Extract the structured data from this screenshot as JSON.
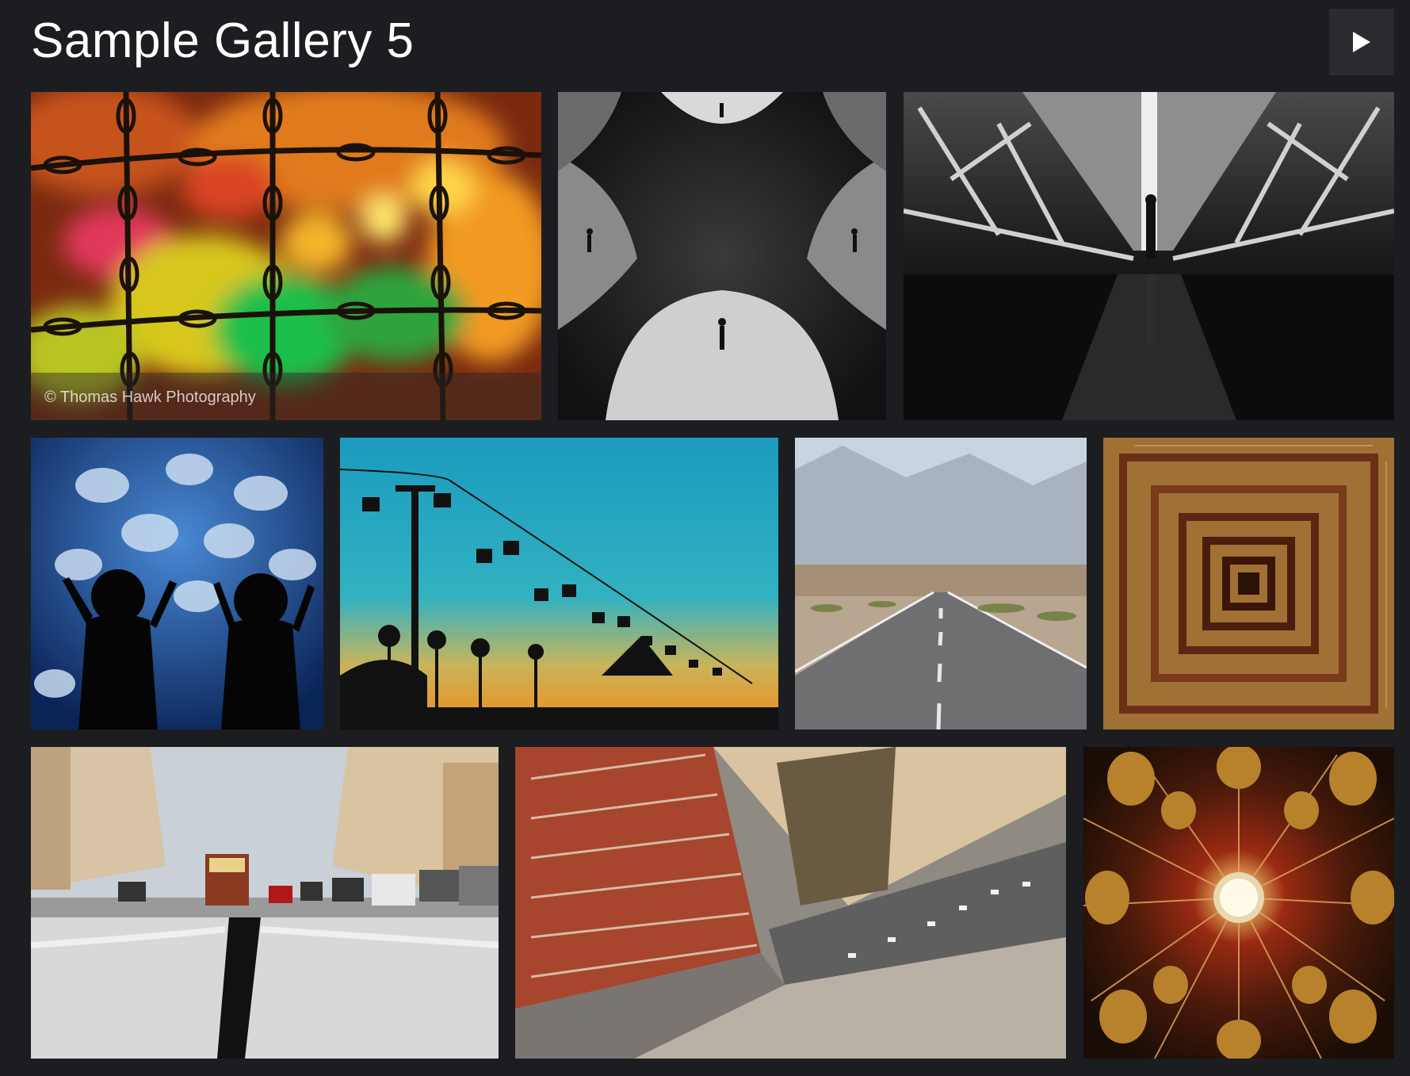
{
  "gallery": {
    "title": "Sample Gallery 5",
    "slideshow_icon": "play-icon"
  },
  "photos": [
    {
      "id": "chains-bokeh",
      "caption": "© Thomas Hawk Photography"
    },
    {
      "id": "mirrored-tunnel"
    },
    {
      "id": "walkway-bridge"
    },
    {
      "id": "aquarium-kids"
    },
    {
      "id": "sky-ride"
    },
    {
      "id": "desert-road"
    },
    {
      "id": "spiral-staircase"
    },
    {
      "id": "cable-car-street"
    },
    {
      "id": "tilt-shift-city"
    },
    {
      "id": "chandelier"
    }
  ]
}
